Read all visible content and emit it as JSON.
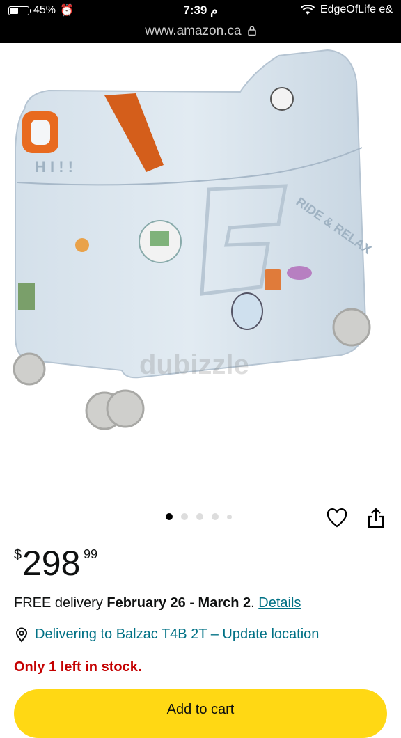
{
  "status_bar": {
    "battery": "45%",
    "battery_level": 0.45,
    "time": "7:39 م",
    "carrier": "EdgeOfLife e&"
  },
  "browser": {
    "url": "www.amazon.ca"
  },
  "gallery": {
    "watermark": "dubizzle",
    "image_count": 5,
    "active_index": 0
  },
  "product": {
    "price_currency": "$",
    "price_whole": "298",
    "price_fraction": "99",
    "delivery_prefix": "FREE delivery ",
    "delivery_dates": "February 26 - March 2",
    "delivery_suffix": ". ",
    "details_link": "Details",
    "location_text": "Delivering to Balzac T4B 2T – Update location",
    "stock_text": "Only 1 left in stock.",
    "add_to_cart": "Add to cart"
  },
  "colors": {
    "link": "#007185",
    "stock_red": "#c40000",
    "cart_yellow": "#ffd814"
  }
}
